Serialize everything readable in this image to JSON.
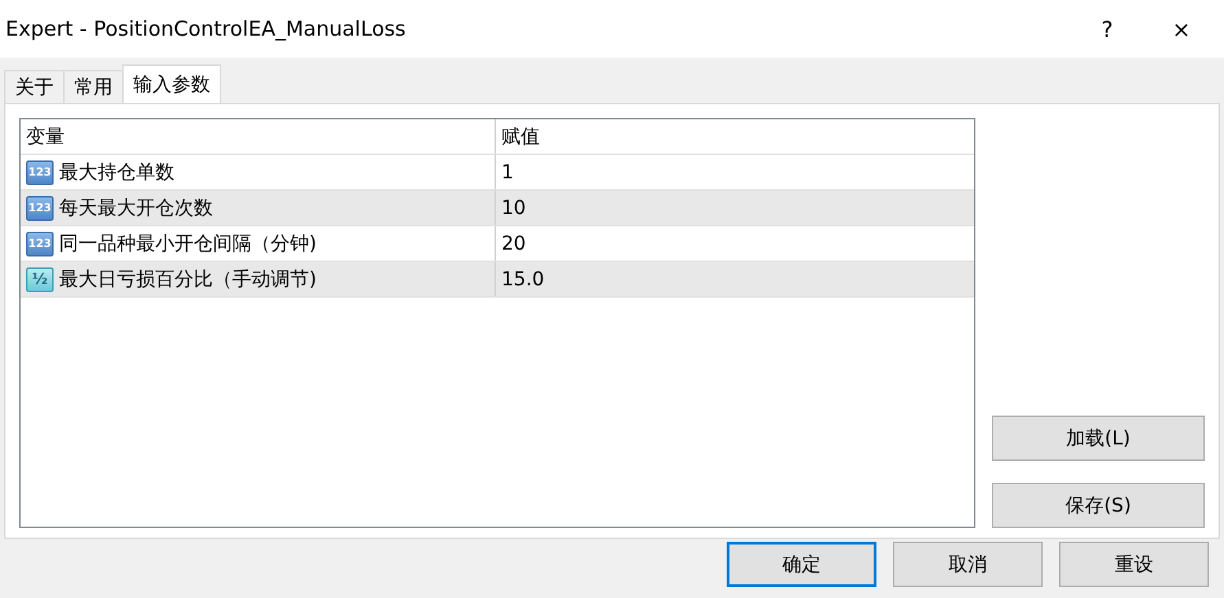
{
  "window": {
    "title": "Expert - PositionControlEA_ManualLoss",
    "help": "?",
    "close": "×"
  },
  "tabs": [
    {
      "label": "关于",
      "selected": false
    },
    {
      "label": "常用",
      "selected": false
    },
    {
      "label": "输入参数",
      "selected": true
    }
  ],
  "table": {
    "columns": [
      "变量",
      "赋值"
    ],
    "rows": [
      {
        "kind": "integer",
        "icon_text": "123",
        "name": "最大持仓单数",
        "value": "1"
      },
      {
        "kind": "integer",
        "icon_text": "123",
        "name": "每天最大开仓次数",
        "value": "10"
      },
      {
        "kind": "integer",
        "icon_text": "123",
        "name": "同一品种最小开仓间隔（分钟)",
        "value": "20"
      },
      {
        "kind": "double",
        "icon_text": "½",
        "name": "最大日亏损百分比（手动调节)",
        "value": "15.0"
      }
    ]
  },
  "side_buttons": [
    "加载(L)",
    "保存(S)"
  ],
  "buttons": [
    {
      "label": "确定",
      "selected": true
    },
    {
      "label": "取消",
      "selected": false
    },
    {
      "label": "重设",
      "selected": false
    }
  ]
}
